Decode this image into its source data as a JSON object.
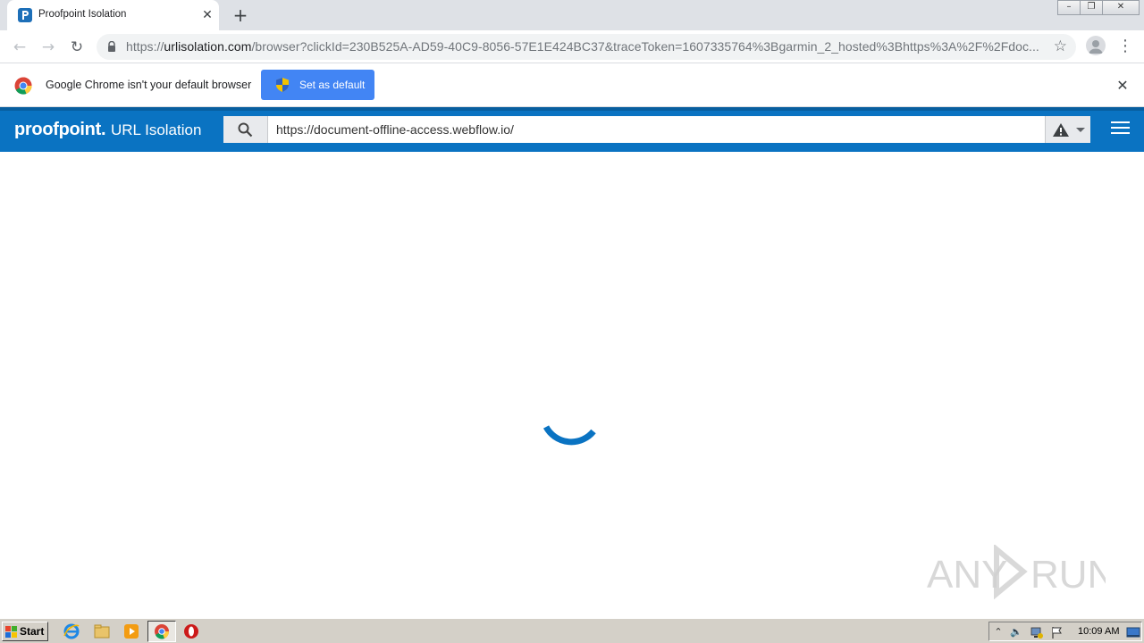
{
  "browser": {
    "tab": {
      "title": "Proofpoint Isolation",
      "close_glyph": "✕"
    },
    "new_tab_glyph": "+",
    "window_controls": {
      "minimize": "–",
      "restore": "❐",
      "close": "✕"
    },
    "nav": {
      "back": "←",
      "forward": "→",
      "reload": "↻"
    },
    "address": {
      "scheme": "https://",
      "host": "urlisolation.com",
      "path": "/browser?clickId=230B525A-AD59-40C9-8056-57E1E424BC37&traceToken=1607335764%3Bgarmin_2_hosted%3Bhttps%3A%2F%2Fdoc..."
    },
    "star_glyph": "☆",
    "menu_glyph": "⋮"
  },
  "infobar": {
    "message": "Google Chrome isn't your default browser",
    "button_label": "Set as default",
    "close_glyph": "✕"
  },
  "proofpoint": {
    "brand": "proofpoint.",
    "product": "URL Isolation",
    "url_value": "https://document-offline-access.webflow.io/",
    "colors": {
      "header": "#0a73c2",
      "spinner": "#0a73c2"
    }
  },
  "content": {
    "watermark": "ANY RUN",
    "status": "loading"
  },
  "taskbar": {
    "start_label": "Start",
    "icons": [
      "internet-explorer-icon",
      "file-explorer-icon",
      "media-player-icon",
      "chrome-icon",
      "opera-icon"
    ],
    "clock": "10:09 AM"
  }
}
